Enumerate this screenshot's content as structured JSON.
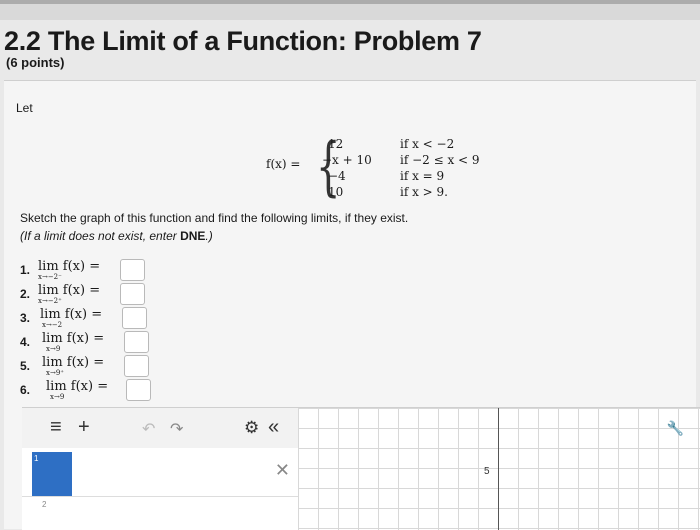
{
  "header": {
    "title": "2.2 The Limit of a Function: Problem 7",
    "points": "(6 points)"
  },
  "problem": {
    "let": "Let",
    "lhs": "f(x) =",
    "cases": [
      {
        "value": "12",
        "condition": "if x < −2"
      },
      {
        "value": "−x + 10",
        "condition": "if −2 ≤ x < 9"
      },
      {
        "value": "−4",
        "condition": "if x = 9"
      },
      {
        "value": "10",
        "condition": "if x > 9."
      }
    ],
    "instruction": "Sketch the graph of this function and find the following limits, if they exist.",
    "dne_note_prefix": "(If a limit does not exist, enter ",
    "dne_word": "DNE",
    "dne_note_suffix": ".)"
  },
  "limits": [
    {
      "num": "1.",
      "expr": "lim f(x) =",
      "sub": "x→−2⁻",
      "answer": ""
    },
    {
      "num": "2.",
      "expr": "lim f(x) =",
      "sub": "x→−2⁺",
      "answer": ""
    },
    {
      "num": "3.",
      "expr": "lim f(x) =",
      "sub": "x→−2",
      "answer": ""
    },
    {
      "num": "4.",
      "expr": "lim f(x) =",
      "sub": "x→9",
      "answer": ""
    },
    {
      "num": "5.",
      "expr": "lim f(x) =",
      "sub": "x→9⁺",
      "answer": ""
    },
    {
      "num": "6.",
      "expr": "lim f(x) =",
      "sub": "x→9",
      "answer": ""
    }
  ],
  "calculator": {
    "menu_icon": "≡",
    "add_icon": "+",
    "undo_icon": "↶",
    "redo_icon": "↷",
    "gear_icon": "⚙",
    "collapse_icon": "«",
    "close_icon": "✕",
    "wrench_icon": "🔧",
    "row1_index": "1",
    "row2_index": "2",
    "axis_tick": "5",
    "accent": "#2e6fc4"
  }
}
